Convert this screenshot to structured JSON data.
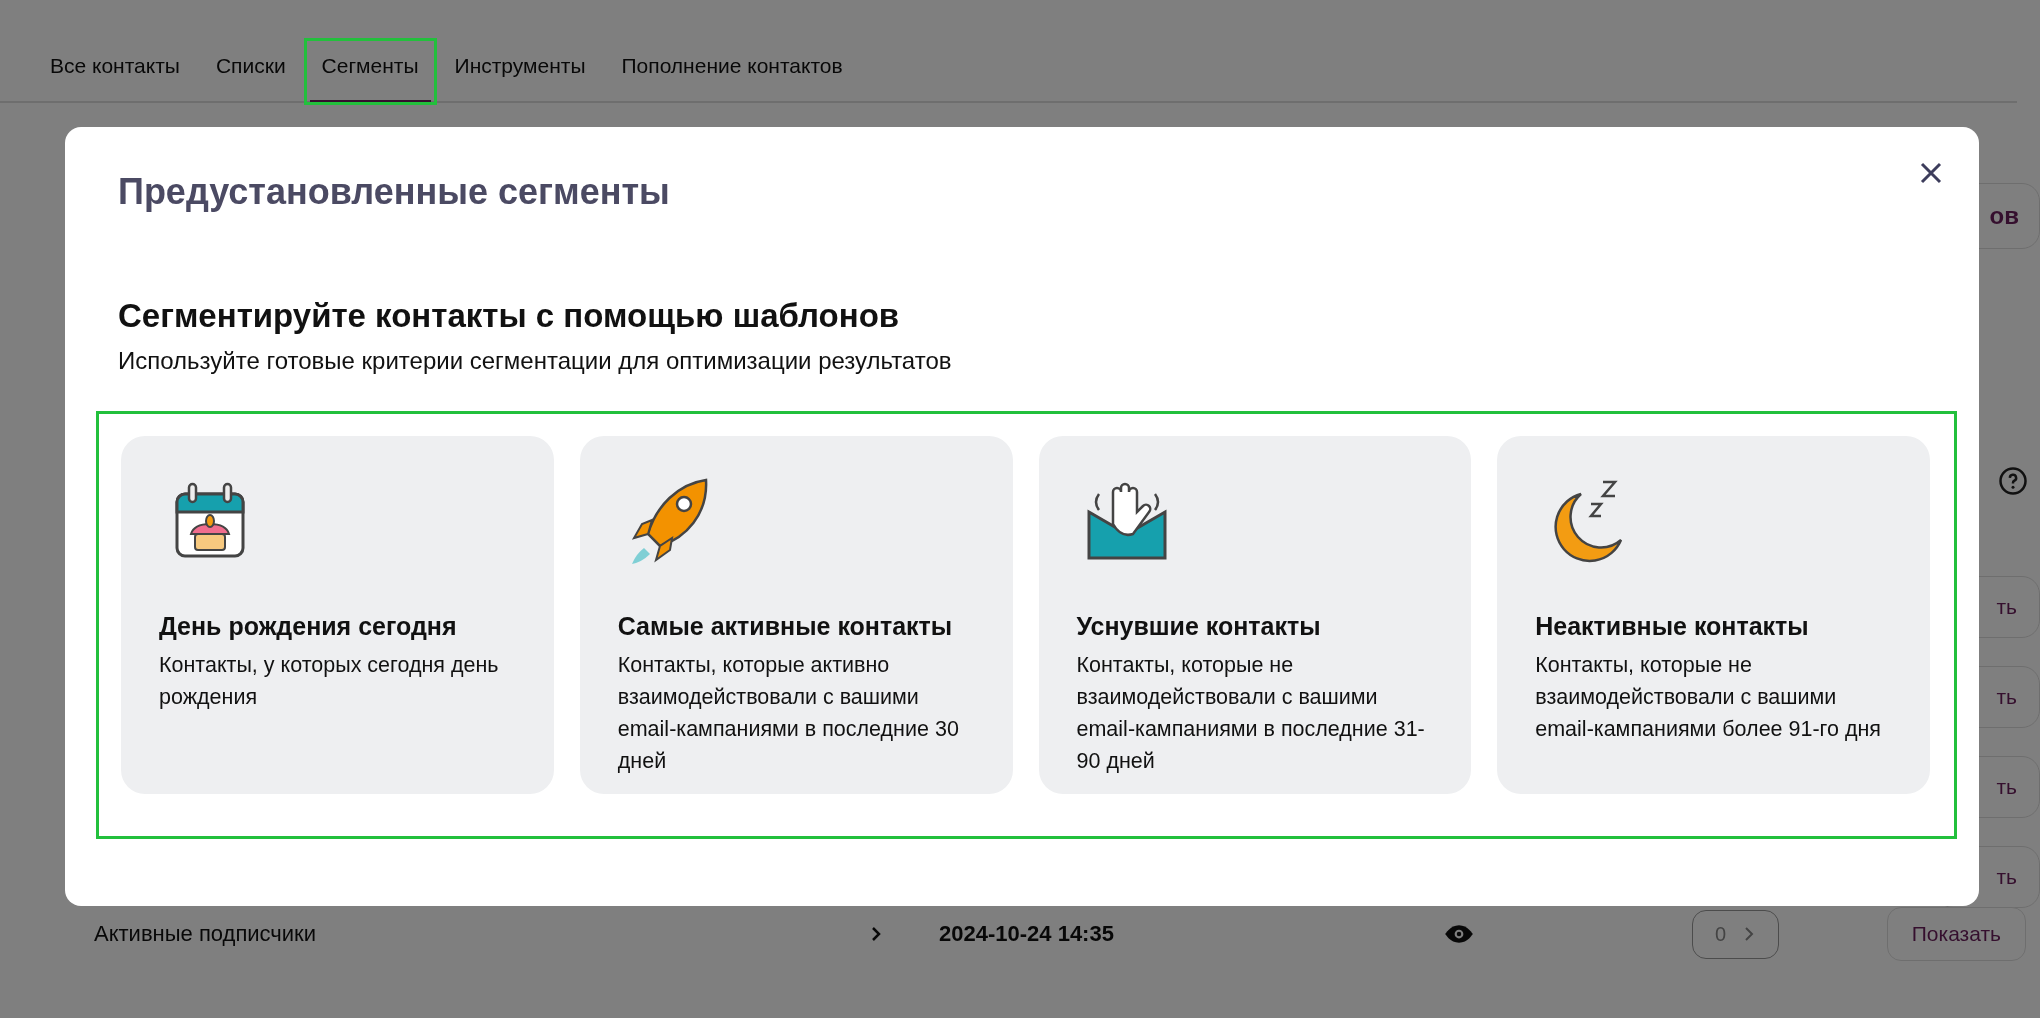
{
  "tabs": [
    {
      "label": "Все контакты",
      "selected": false,
      "highlighted": false
    },
    {
      "label": "Списки",
      "selected": false,
      "highlighted": false
    },
    {
      "label": "Сегменты",
      "selected": true,
      "highlighted": true
    },
    {
      "label": "Инструменты",
      "selected": false,
      "highlighted": false
    },
    {
      "label": "Пополнение контактов",
      "selected": false,
      "highlighted": false
    }
  ],
  "background": {
    "top_button_fragment": "ов",
    "row_button_fragments": [
      "ть",
      "ть",
      "ть",
      "ть"
    ],
    "row": {
      "name": "Активные подписчики",
      "date": "2024-10-24 14:35",
      "count": "0",
      "button": "Показать"
    }
  },
  "dialog": {
    "title": "Предустановленные сегменты",
    "heading": "Сегментируйте контакты с помощью шаблонов",
    "subtitle": "Используйте готовые критерии сегментации для оптимизации результатов",
    "cards_highlighted": true,
    "cards": [
      {
        "kind": "birthday",
        "title": "День рождения сегодня",
        "description": "Контакты, у которых сегодня день рождения"
      },
      {
        "kind": "active",
        "title": "Самые активные контакты",
        "description": "Контакты, которые активно взаимодействовали с вашими email-кампаниями в последние 30 дней"
      },
      {
        "kind": "dormant",
        "title": "Уснувшие контакты",
        "description": "Контакты, которые не взаимодействовали с вашими email-кампаниями в последние 31-90 дней"
      },
      {
        "kind": "inactive",
        "title": "Неактивные контакты",
        "description": "Контакты, которые не взаимодействовали с вашими email-кампаниями более 91-го дня"
      }
    ]
  }
}
